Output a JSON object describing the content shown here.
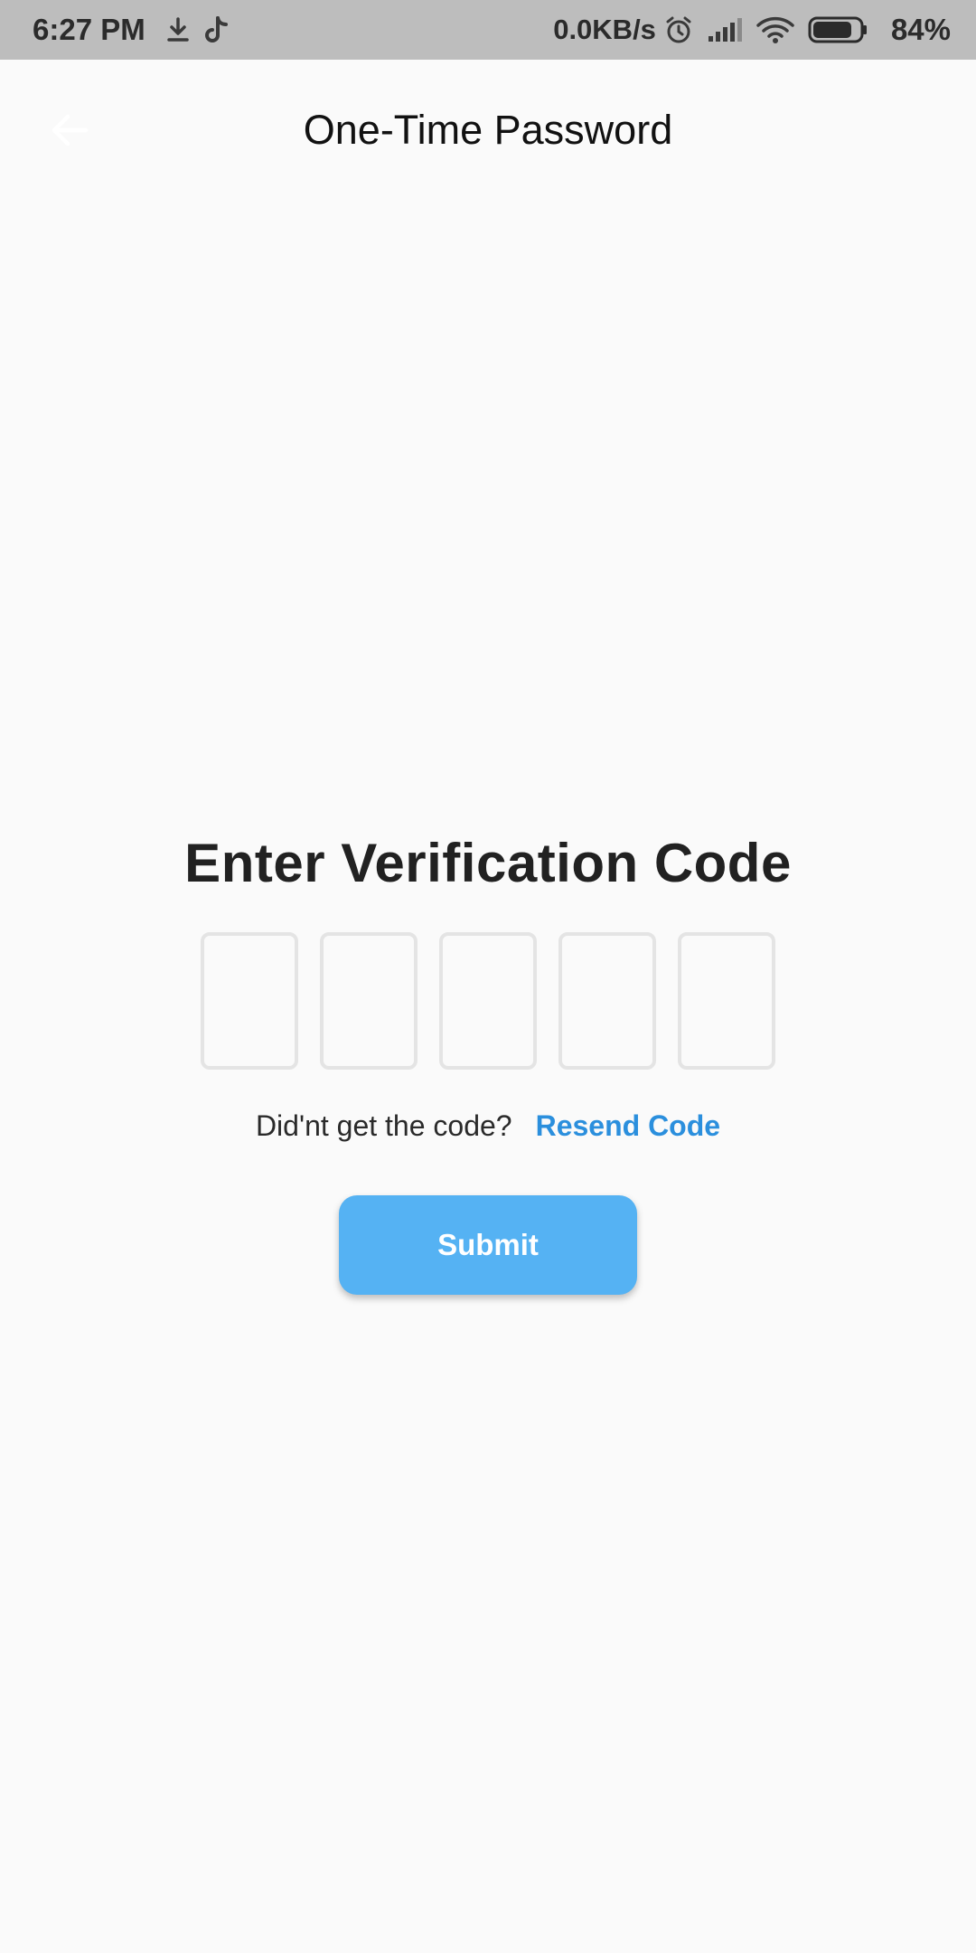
{
  "status_bar": {
    "time": "6:27 PM",
    "left_icons": [
      "download-icon",
      "tiktok-icon"
    ],
    "network_speed": "0.0KB/s",
    "right_icons": [
      "alarm-icon",
      "signal-icon",
      "wifi-icon",
      "battery-icon"
    ],
    "battery_percent": "84%",
    "battery_level": 0.84
  },
  "app_bar": {
    "title": "One-Time Password",
    "back_icon": "arrow-left-icon"
  },
  "verification": {
    "heading": "Enter Verification Code",
    "code_length": 5,
    "code_values": [
      "",
      "",
      "",
      "",
      ""
    ],
    "resend_prompt": "Did'nt get the code?",
    "resend_label": "Resend Code",
    "submit_label": "Submit"
  },
  "colors": {
    "background": "#fafafa",
    "status_bar": "#bdbdbd",
    "accent_link": "#2b8fdd",
    "submit_button": "#55b2f3",
    "input_border": "#e4e4e4"
  }
}
